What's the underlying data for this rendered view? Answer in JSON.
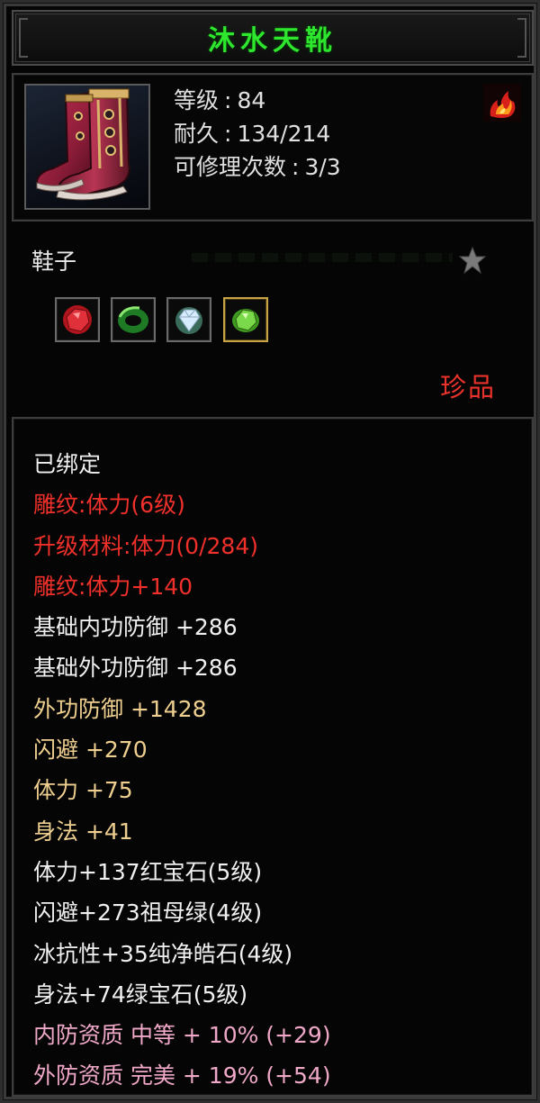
{
  "item": {
    "name": "沐水天靴",
    "level_label": "等级",
    "level": "84",
    "durability_label": "耐久",
    "durability": "134/214",
    "repair_label": "可修理次数",
    "repair": "3/3",
    "category": "鞋子",
    "rarity": "珍品"
  },
  "gems": [
    {
      "name": "ruby-gem",
      "color": "#d0202a"
    },
    {
      "name": "emerald-ring-gem",
      "color": "#2fa032"
    },
    {
      "name": "diamond-gem",
      "color": "#cfe6ff"
    },
    {
      "name": "green-gem",
      "color": "#5fcf3a"
    }
  ],
  "attributes": [
    {
      "text": "已绑定",
      "color": "white"
    },
    {
      "text": "雕纹:体力(6级)",
      "color": "red"
    },
    {
      "text": "升级材料:体力(0/284)",
      "color": "red"
    },
    {
      "text": "雕纹:体力+140",
      "color": "red"
    },
    {
      "text": "基础内功防御 +286",
      "color": "white"
    },
    {
      "text": "基础外功防御 +286",
      "color": "white"
    },
    {
      "text": "外功防御 +1428",
      "color": "gold"
    },
    {
      "text": "闪避 +270",
      "color": "gold"
    },
    {
      "text": "体力 +75",
      "color": "gold"
    },
    {
      "text": "身法 +41",
      "color": "gold"
    },
    {
      "text": "体力+137红宝石(5级)",
      "color": "white"
    },
    {
      "text": "闪避+273祖母绿(4级)",
      "color": "white"
    },
    {
      "text": "冰抗性+35纯净皓石(4级)",
      "color": "white"
    },
    {
      "text": "身法+74绿宝石(5级)",
      "color": "white"
    },
    {
      "text": "内防资质 中等 + 10% (+29)",
      "color": "pink"
    },
    {
      "text": "外防资质 完美 + 19% (+54)",
      "color": "pink"
    }
  ],
  "colors": {
    "title": "#2ee62e",
    "red": "#f0302a",
    "gold": "#eecf8f",
    "pink": "#f0a8c8",
    "white": "#f0f0f0"
  },
  "icons": {
    "item": "boots-icon",
    "top_right": "flame-icon",
    "favorite": "star-icon"
  }
}
